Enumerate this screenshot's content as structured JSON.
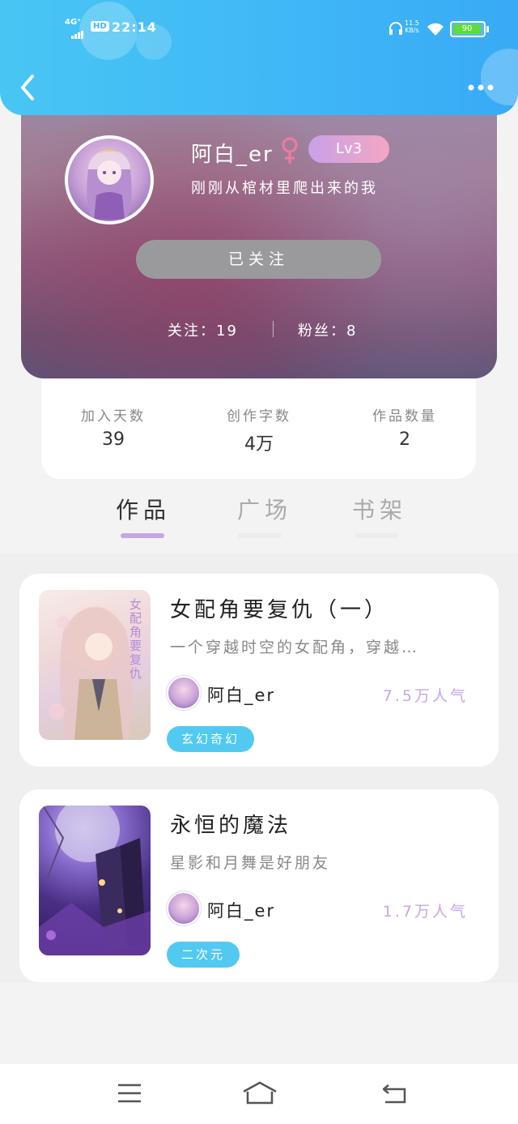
{
  "status_bar": {
    "signal": "4G⁺",
    "hd": "HD",
    "time": "22:14",
    "speed_value": "11.5",
    "speed_unit": "KB/s",
    "battery": "90"
  },
  "header": {
    "back_icon": "chevron-left-icon",
    "more_icon": "ellipsis-icon"
  },
  "profile": {
    "username": "阿白_er",
    "gender_icon": "female-icon",
    "level": "Lv3",
    "bio": "刚刚从棺材里爬出来的我",
    "follow_button": "已关注",
    "following_text": "关注：19",
    "fans_text": "粉丝：8"
  },
  "info": {
    "items": [
      {
        "label": "加入天数",
        "value": "39"
      },
      {
        "label": "创作字数",
        "value": "4万"
      },
      {
        "label": "作品数量",
        "value": "2"
      }
    ]
  },
  "tabs": [
    {
      "label": "作品",
      "active": true
    },
    {
      "label": "广场",
      "active": false
    },
    {
      "label": "书架",
      "active": false
    }
  ],
  "works": [
    {
      "title": "女配角要复仇（一）",
      "description": "一个穿越时空的女配角，穿越…",
      "author": "阿白_er",
      "popularity": "7.5万人气",
      "tag": "玄幻奇幻",
      "cover_text": "女配角要复仇"
    },
    {
      "title": "永恒的魔法",
      "description": "星影和月舞是好朋友",
      "author": "阿白_er",
      "popularity": "1.7万人气",
      "tag": "二次元"
    }
  ],
  "colors": {
    "header_blue": "#3fb6f7",
    "accent_purple": "#c6a6e6",
    "tag_blue": "#52c9f0",
    "follow_gray": "#9a9a9c"
  },
  "navbar": {
    "menu_icon": "menu-icon",
    "home_icon": "home-icon",
    "back_icon": "return-icon"
  }
}
